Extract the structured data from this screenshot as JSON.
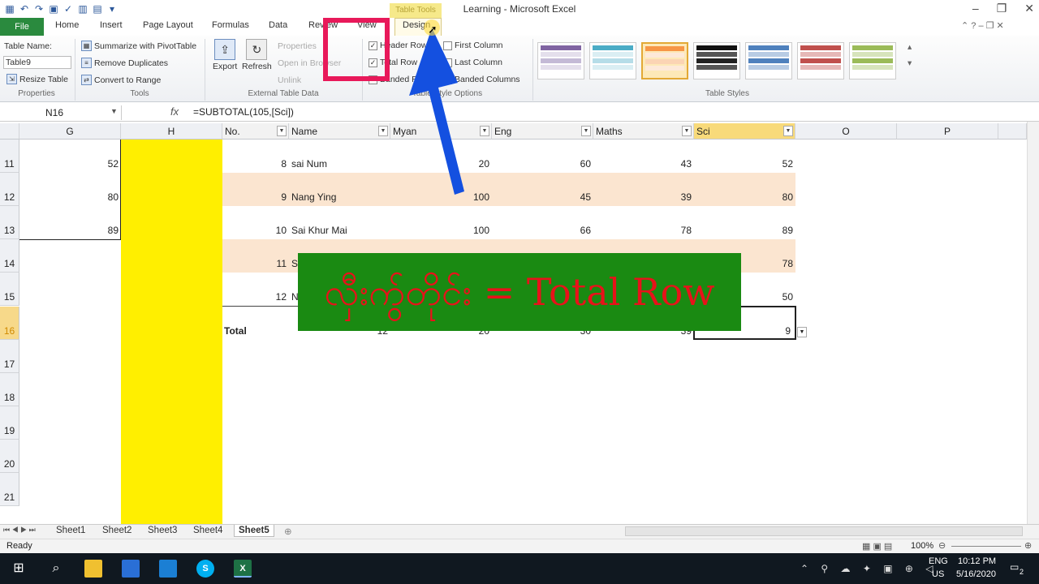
{
  "window": {
    "title": "Learning - Microsoft Excel",
    "contextual_tab": "Table Tools"
  },
  "tabs": [
    "File",
    "Home",
    "Insert",
    "Page Layout",
    "Formulas",
    "Data",
    "Review",
    "View",
    "Design"
  ],
  "ribbon": {
    "properties": {
      "label": "Properties",
      "table_name_label": "Table Name:",
      "table_name": "Table9",
      "resize": "Resize Table"
    },
    "tools": {
      "label": "Tools",
      "pivot": "Summarize with PivotTable",
      "dupes": "Remove Duplicates",
      "range": "Convert to Range"
    },
    "external": {
      "label": "External Table Data",
      "export": "Export",
      "refresh": "Refresh",
      "properties": "Properties",
      "open_browser": "Open in Browser",
      "unlink": "Unlink"
    },
    "options": {
      "label": "Table Style Options",
      "header_row": "Header Row",
      "total_row": "Total Row",
      "banded_rows": "Banded Rows",
      "first_column": "First Column",
      "last_column": "Last Column",
      "banded_columns": "Banded Columns"
    },
    "styles": {
      "label": "Table Styles"
    }
  },
  "formula_bar": {
    "cell": "N16",
    "fx": "fx",
    "formula": "=SUBTOTAL(105,[Sci])"
  },
  "columns": {
    "G": "G",
    "H": "H",
    "O": "O",
    "P": "P"
  },
  "table_headers": [
    "No.",
    "Name",
    "Myan",
    "Eng",
    "Maths",
    "Sci"
  ],
  "rows": [
    {
      "row": "11",
      "g": "52",
      "no": "8",
      "name": "sai Num",
      "myan": "20",
      "eng": "60",
      "maths": "43",
      "sci": "52"
    },
    {
      "row": "12",
      "g": "80",
      "no": "9",
      "name": "Nang Ying",
      "myan": "100",
      "eng": "45",
      "maths": "39",
      "sci": "80"
    },
    {
      "row": "13",
      "g": "89",
      "no": "10",
      "name": "Sai Khur Mai",
      "myan": "100",
      "eng": "66",
      "maths": "78",
      "sci": "89"
    },
    {
      "row": "14",
      "g": "",
      "no": "11",
      "name": "S",
      "myan": "",
      "eng": "",
      "maths": "",
      "sci": "78"
    },
    {
      "row": "15",
      "g": "",
      "no": "12",
      "name": "N",
      "myan": "",
      "eng": "",
      "maths": "",
      "sci": "50"
    }
  ],
  "total_row": {
    "row": "16",
    "label": "Total",
    "no": "12",
    "myan": "20",
    "eng": "30",
    "maths": "39",
    "sci": "9"
  },
  "empty_rows": [
    "17",
    "18",
    "19",
    "20",
    "21"
  ],
  "overlay_text": "လှီး​ကွ်​တိုင်း = Total Row",
  "sheets": [
    "Sheet1",
    "Sheet2",
    "Sheet3",
    "Sheet4",
    "Sheet5"
  ],
  "active_sheet": "Sheet5",
  "status": {
    "ready": "Ready",
    "zoom": "100%"
  },
  "taskbar": {
    "lang": "ENG",
    "region": "US",
    "time": "10:12 PM",
    "date": "5/16/2020",
    "notifications": "2"
  },
  "colors": {
    "file_tab": "#2a8a3e",
    "band": "#fbe5d0",
    "highlight": "#ffef00",
    "overlay_bg": "#1a8a12",
    "overlay_text": "#e8121a",
    "arrow": "#1450e0",
    "frame": "#e8195a"
  }
}
